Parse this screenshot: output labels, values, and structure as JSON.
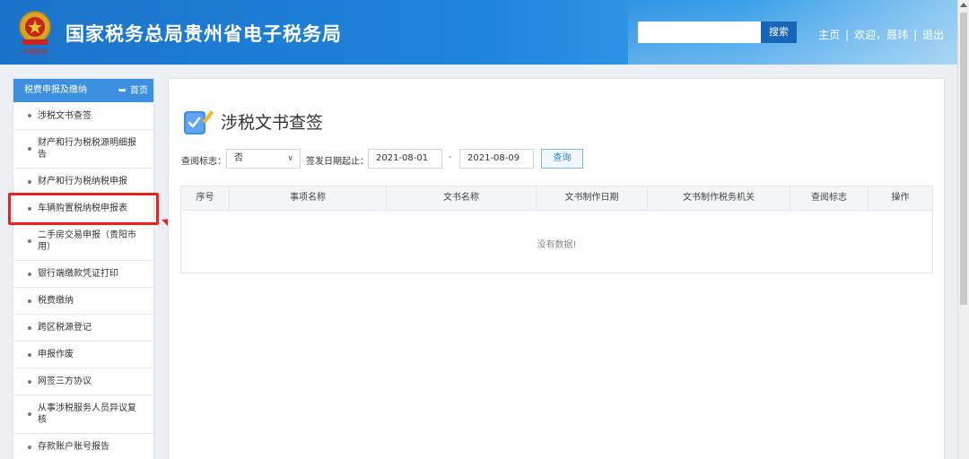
{
  "header": {
    "emblem_text": "中国税务",
    "title": "国家税务总局贵州省电子税务局",
    "search_placeholder": "",
    "search_button": "搜索",
    "links": [
      "主页",
      "欢迎，聂玮",
      "退出"
    ],
    "separator": "|"
  },
  "sidebar": {
    "heading": "税费申报及缴纳",
    "home_arrow": "➥",
    "home_label": "首页",
    "items": [
      {
        "label": "涉税文书查签"
      },
      {
        "label": "财产和行为税税源明细报告"
      },
      {
        "label": "财产和行为税纳税申报"
      },
      {
        "label": "车辆购置税纳税申报表",
        "highlighted": true
      },
      {
        "label": "二手房交易申报（贵阳市用）"
      },
      {
        "label": "银行端缴款凭证打印"
      },
      {
        "label": "税费缴纳"
      },
      {
        "label": "跨区税源登记"
      },
      {
        "label": "申报作废"
      },
      {
        "label": "网签三方协议"
      },
      {
        "label": "从事涉税服务人员异议复核"
      },
      {
        "label": "存款账户账号报告"
      }
    ]
  },
  "main": {
    "title": "涉税文书查签",
    "filters": {
      "review_label": "查阅标志：",
      "review_value": "否",
      "date_label": "签发日期起止：",
      "start_date": "2021-08-01",
      "dash": "-",
      "end_date": "2021-08-09",
      "query_button": "查询"
    },
    "table": {
      "columns": [
        "序号",
        "事项名称",
        "文书名称",
        "文书制作日期",
        "文书制作税务机关",
        "查阅标志",
        "操作"
      ],
      "empty_text": "没有数据!"
    }
  },
  "colors": {
    "header_blue": "#1f84dc",
    "sidebar_head": "#3d8fe0",
    "highlight_red": "#e8231e",
    "accent_blue": "#2b7cd3"
  }
}
